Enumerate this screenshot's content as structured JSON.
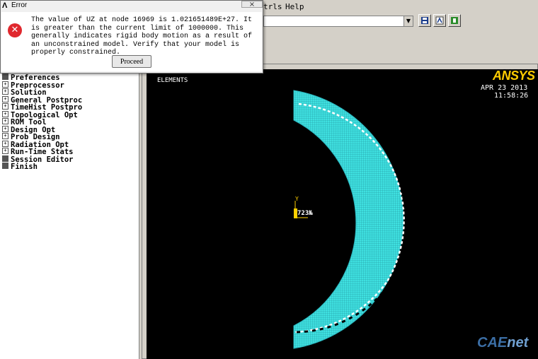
{
  "menubar": {
    "items": [
      "trls",
      "Help"
    ]
  },
  "dialog": {
    "title": "Error",
    "close_glyph": "×",
    "message": "The value of UZ at node 16969 is 1.021651489E+27.  It is greater than the current limit of 1000000.  This generally indicates rigid body motion as a result of an unconstrained model.  Verify that your model is properly constrained.",
    "proceed_label": "Proceed",
    "icon": "error-icon"
  },
  "main_menu": {
    "items": [
      {
        "label": "Preferences",
        "box": "filled"
      },
      {
        "label": "Preprocessor",
        "box": "plus"
      },
      {
        "label": "Solution",
        "box": "plus"
      },
      {
        "label": "General Postproc",
        "box": "plus"
      },
      {
        "label": "TimeHist Postpro",
        "box": "plus"
      },
      {
        "label": "Topological Opt",
        "box": "plus"
      },
      {
        "label": "ROM Tool",
        "box": "plus"
      },
      {
        "label": "Design Opt",
        "box": "plus"
      },
      {
        "label": "Prob Design",
        "box": "plus"
      },
      {
        "label": "Radiation Opt",
        "box": "plus"
      },
      {
        "label": "Run-Time Stats",
        "box": "plus"
      },
      {
        "label": "Session Editor",
        "box": "filled"
      },
      {
        "label": "Finish",
        "box": "filled"
      }
    ]
  },
  "graphics": {
    "plot_label": "ELEMENTS",
    "date": "APR 23 2013",
    "time": "11:58:26",
    "logo_main": "ANSYS",
    "triad_axis": "Y",
    "triad_label": "723№",
    "mesh_color": "#3fe0e0"
  },
  "watermark": {
    "part1": "CAE",
    "part2": "net"
  }
}
